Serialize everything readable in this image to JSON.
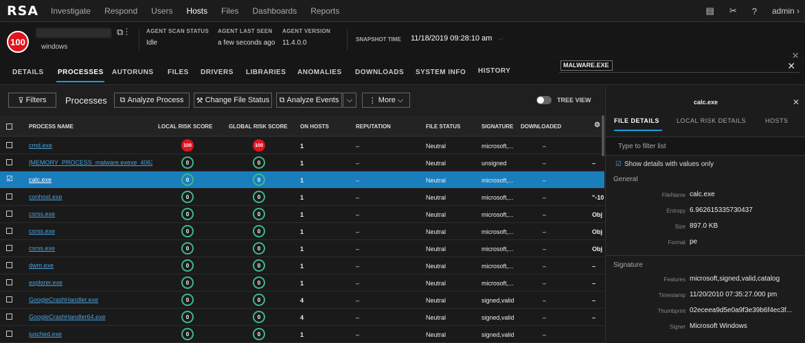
{
  "nav": {
    "logo": "RSA",
    "items": [
      "Investigate",
      "Respond",
      "Users",
      "Hosts",
      "Files",
      "Dashboards",
      "Reports"
    ],
    "user": "admin"
  },
  "host": {
    "risk": "100",
    "os": "windows",
    "agent_scan_status_label": "AGENT SCAN STATUS",
    "agent_scan_status": "Idle",
    "agent_last_seen_label": "AGENT LAST SEEN",
    "agent_last_seen": "a few seconds ago",
    "agent_version_label": "AGENT VERSION",
    "agent_version": "11.4.0.0",
    "snapshot_label": "SNAPSHOT TIME",
    "snapshot": "11/18/2019 09:28:10 am"
  },
  "tabs": [
    "DETAILS",
    "PROCESSES",
    "AUTORUNS",
    "FILES",
    "DRIVERS",
    "LIBRARIES",
    "ANOMALIES",
    "DOWNLOADS",
    "SYSTEM INFO",
    "HISTORY"
  ],
  "search_chip": "MALWARE.EXE",
  "toolbar": {
    "filters": "Filters",
    "processes": "Processes",
    "analyze_process": "Analyze Process",
    "change_status": "Change File Status",
    "analyze_events": "Analyze Events",
    "more": "More",
    "tree_view": "TREE VIEW"
  },
  "columns": [
    "PROCESS NAME",
    "LOCAL RISK SCORE",
    "GLOBAL RISK SCORE",
    "ON HOSTS",
    "REPUTATION",
    "FILE STATUS",
    "SIGNATURE",
    "DOWNLOADED"
  ],
  "rows": [
    {
      "name": "cmd.exe",
      "local": "100",
      "global": "100",
      "hosts": "1",
      "rep": "–",
      "status": "Neutral",
      "sig": "microsoft,...",
      "dl": "–",
      "extra": ""
    },
    {
      "name": "[MEMORY_PROCESS_malware.exexe_4063...",
      "local": "0",
      "global": "0",
      "hosts": "1",
      "rep": "–",
      "status": "Neutral",
      "sig": "unsigned",
      "dl": "–",
      "extra": "–"
    },
    {
      "name": "calc.exe",
      "local": "0",
      "global": "0",
      "hosts": "1",
      "rep": "–",
      "status": "Neutral",
      "sig": "microsoft,...",
      "dl": "–",
      "extra": ""
    },
    {
      "name": "conhost.exe",
      "local": "0",
      "global": "0",
      "hosts": "1",
      "rep": "–",
      "status": "Neutral",
      "sig": "microsoft,...",
      "dl": "–",
      "extra": "\"-10"
    },
    {
      "name": "csrss.exe",
      "local": "0",
      "global": "0",
      "hosts": "1",
      "rep": "–",
      "status": "Neutral",
      "sig": "microsoft,...",
      "dl": "–",
      "extra": "Obj"
    },
    {
      "name": "csrss.exe",
      "local": "0",
      "global": "0",
      "hosts": "1",
      "rep": "–",
      "status": "Neutral",
      "sig": "microsoft,...",
      "dl": "–",
      "extra": "Obj"
    },
    {
      "name": "csrss.exe",
      "local": "0",
      "global": "0",
      "hosts": "1",
      "rep": "–",
      "status": "Neutral",
      "sig": "microsoft,...",
      "dl": "–",
      "extra": "Obj"
    },
    {
      "name": "dwm.exe",
      "local": "0",
      "global": "0",
      "hosts": "1",
      "rep": "–",
      "status": "Neutral",
      "sig": "microsoft,...",
      "dl": "–",
      "extra": "–"
    },
    {
      "name": "explorer.exe",
      "local": "0",
      "global": "0",
      "hosts": "1",
      "rep": "–",
      "status": "Neutral",
      "sig": "microsoft,...",
      "dl": "–",
      "extra": "–"
    },
    {
      "name": "GoogleCrashHandler.exe",
      "local": "0",
      "global": "0",
      "hosts": "4",
      "rep": "–",
      "status": "Neutral",
      "sig": "signed,valid",
      "dl": "–",
      "extra": "–"
    },
    {
      "name": "GoogleCrashHandler64.exe",
      "local": "0",
      "global": "0",
      "hosts": "4",
      "rep": "–",
      "status": "Neutral",
      "sig": "signed,valid",
      "dl": "–",
      "extra": "–"
    },
    {
      "name": "jusched.exe",
      "local": "0",
      "global": "0",
      "hosts": "1",
      "rep": "–",
      "status": "Neutral",
      "sig": "signed,valid",
      "dl": "–",
      "extra": ""
    }
  ],
  "panel": {
    "title": "calc.exe",
    "tabs": [
      "FILE DETAILS",
      "LOCAL RISK DETAILS",
      "HOSTS"
    ],
    "filter_placeholder": "Type to filter list",
    "show_details": "Show details with values only",
    "general": "General",
    "fields": [
      {
        "k": "FileName",
        "v": "calc.exe"
      },
      {
        "k": "Entropy",
        "v": "6.962615335730437"
      },
      {
        "k": "Size",
        "v": "897.0 KB"
      },
      {
        "k": "Format",
        "v": "pe"
      }
    ],
    "signature": "Signature",
    "sig_fields": [
      {
        "k": "Features",
        "v": "microsoft,signed,valid,catalog"
      },
      {
        "k": "Timestamp",
        "v": "11/20/2010 07:35:27.000 pm"
      },
      {
        "k": "Thumbprint",
        "v": "02eceea9d5e0a9f3e39b6f4ec3f..."
      },
      {
        "k": "Signer",
        "v": "Microsoft Windows"
      }
    ]
  }
}
